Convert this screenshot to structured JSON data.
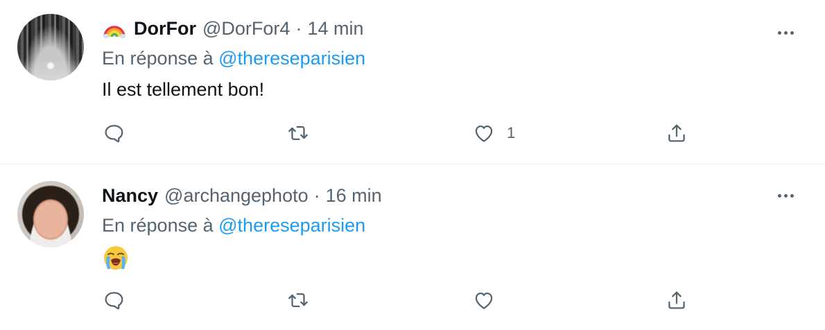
{
  "tweets": [
    {
      "name": "DorFor",
      "name_emoji": "rainbow-emoji",
      "handle": "@DorFor4",
      "separator": "·",
      "time": "14 min",
      "reply_prefix": "En réponse à",
      "reply_mention": "@thereseparisien",
      "text": "Il est tellement bon!",
      "like_count": "1"
    },
    {
      "name": "Nancy",
      "handle": "@archangephoto",
      "separator": "·",
      "time": "16 min",
      "reply_prefix": "En réponse à",
      "reply_mention": "@thereseparisien",
      "text_emoji": "loudly-crying-face-emoji",
      "like_count": ""
    }
  ],
  "colors": {
    "text_primary": "#0f1419",
    "text_secondary": "#536471",
    "mention": "#1d9bf0",
    "divider": "#eff3f4"
  },
  "icons": [
    "reply-icon",
    "retweet-icon",
    "like-icon",
    "share-icon",
    "more-options-icon"
  ]
}
